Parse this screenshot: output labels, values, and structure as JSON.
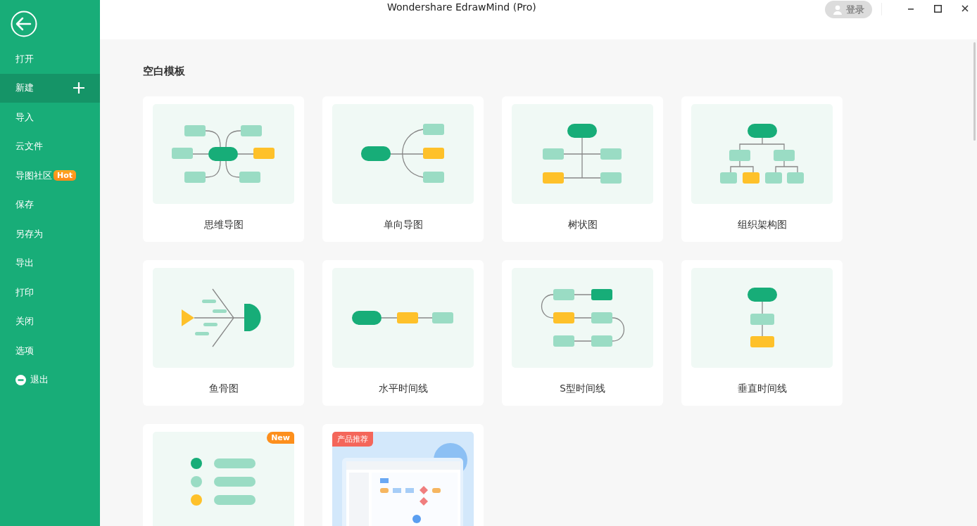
{
  "window": {
    "title": "Wondershare EdrawMind (Pro)",
    "login": "登录"
  },
  "sidebar": {
    "items": [
      {
        "label": "打开",
        "selected": false,
        "kind": "plain"
      },
      {
        "label": "新建",
        "selected": true,
        "kind": "add"
      },
      {
        "label": "导入",
        "selected": false,
        "kind": "plain"
      },
      {
        "label": "云文件",
        "selected": false,
        "kind": "plain"
      },
      {
        "label": "导图社区",
        "selected": false,
        "kind": "badge",
        "badge": "Hot"
      },
      {
        "label": "保存",
        "selected": false,
        "kind": "plain"
      },
      {
        "label": "另存为",
        "selected": false,
        "kind": "plain"
      },
      {
        "label": "导出",
        "selected": false,
        "kind": "plain"
      },
      {
        "label": "打印",
        "selected": false,
        "kind": "plain"
      },
      {
        "label": "关闭",
        "selected": false,
        "kind": "plain"
      },
      {
        "label": "选项",
        "selected": false,
        "kind": "plain"
      },
      {
        "label": "退出",
        "selected": false,
        "kind": "exit"
      }
    ]
  },
  "section": {
    "title": "空白模板"
  },
  "templates": [
    {
      "label": "思维导图",
      "kind": "mindmap"
    },
    {
      "label": "单向导图",
      "kind": "oneway"
    },
    {
      "label": "树状图",
      "kind": "tree"
    },
    {
      "label": "组织架构图",
      "kind": "org"
    },
    {
      "label": "鱼骨图",
      "kind": "fishbone"
    },
    {
      "label": "水平时间线",
      "kind": "htimeline"
    },
    {
      "label": "S型时间线",
      "kind": "stimeline"
    },
    {
      "label": "垂直时间线",
      "kind": "vtimeline"
    },
    {
      "kind": "list",
      "badge": {
        "text": "New",
        "kind": "new"
      }
    },
    {
      "kind": "product",
      "badge": {
        "text": "产品推荐",
        "kind": "promo"
      }
    }
  ]
}
